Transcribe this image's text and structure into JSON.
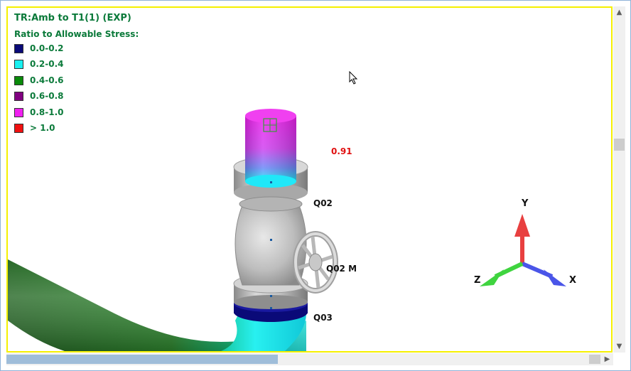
{
  "title": "TR:Amb to T1(1)  (EXP)",
  "legend": {
    "heading": "Ratio to Allowable Stress:",
    "items": [
      {
        "label": "0.0-0.2",
        "color": "#0a0a78"
      },
      {
        "label": "0.2-0.4",
        "color": "#19f0f0"
      },
      {
        "label": "0.4-0.6",
        "color": "#0a8a0a"
      },
      {
        "label": "0.6-0.8",
        "color": "#800080"
      },
      {
        "label": "0.8-1.0",
        "color": "#f020f0"
      },
      {
        "label": "> 1.0",
        "color": "#f01010"
      }
    ]
  },
  "annotations": {
    "max_ratio": "0.91",
    "nodes": [
      "Q02",
      "Q02 M",
      "Q03"
    ]
  },
  "axes": {
    "x": "X",
    "y": "Y",
    "z": "Z",
    "x_color": "#4a55e8",
    "y_color": "#e84040",
    "z_color": "#3fd43f"
  },
  "scrollbars": {
    "up": "▲",
    "down": "▼",
    "left": "◀",
    "right": "▶"
  }
}
